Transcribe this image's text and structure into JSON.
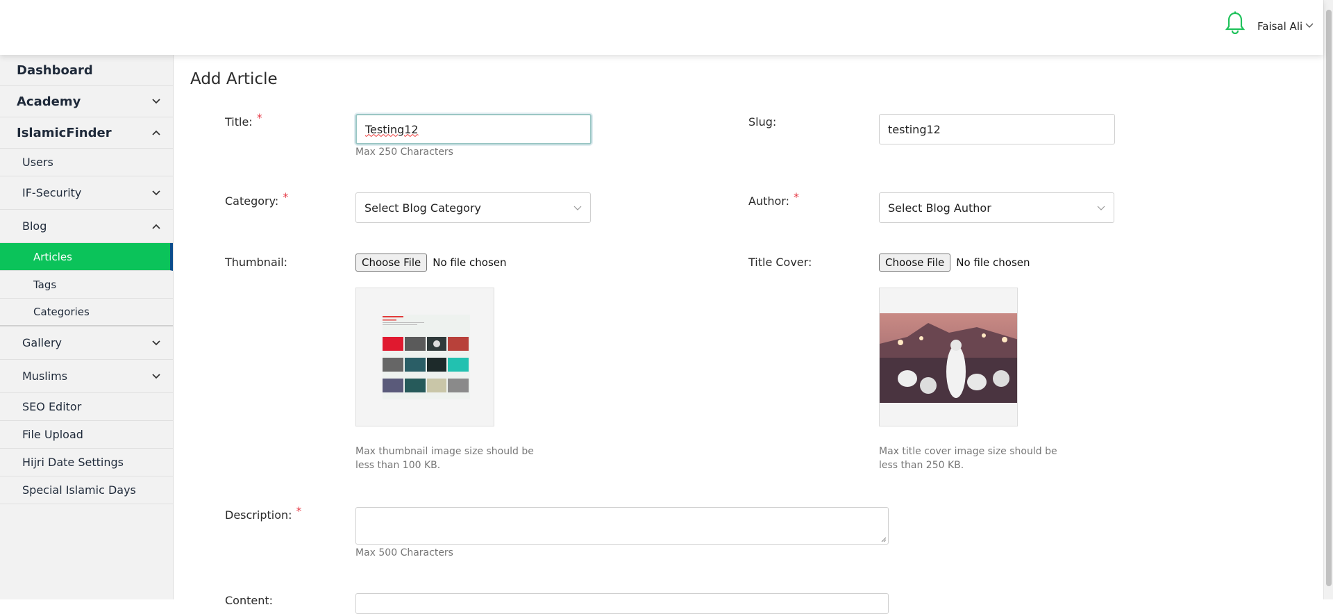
{
  "header": {
    "user_name": "Faisal Ali",
    "bell_color": "#1fc25b"
  },
  "sidebar": {
    "items": [
      {
        "label": "Dashboard"
      },
      {
        "label": "Academy"
      },
      {
        "label": "IslamicFinder"
      },
      {
        "label": "Users"
      },
      {
        "label": "IF-Security"
      },
      {
        "label": "Blog"
      },
      {
        "label": "Articles"
      },
      {
        "label": "Tags"
      },
      {
        "label": "Categories"
      },
      {
        "label": "Gallery"
      },
      {
        "label": "Muslims"
      },
      {
        "label": "SEO Editor"
      },
      {
        "label": "File Upload"
      },
      {
        "label": "Hijri Date Settings"
      },
      {
        "label": "Special Islamic Days"
      }
    ],
    "active_color": "#0bc35a"
  },
  "main": {
    "page_title": "Add Article",
    "title_label": "Title:",
    "title_value": "Testing12",
    "title_hint": "Max 250 Characters",
    "slug_label": "Slug:",
    "slug_value": "testing12",
    "category_label": "Category:",
    "category_value": "Select Blog Category",
    "author_label": "Author:",
    "author_value": "Select Blog Author",
    "thumbnail_label": "Thumbnail:",
    "title_cover_label": "Title Cover:",
    "choose_file": "Choose File",
    "no_file": "No file chosen",
    "thumbnail_hint": "Max thumbnail image size should be less than 100 KB.",
    "cover_hint": "Max title cover image size should be less than 250 KB.",
    "description_label": "Description:",
    "description_hint": "Max 500 Characters",
    "content_label": "Content:",
    "required_mark": "*"
  }
}
